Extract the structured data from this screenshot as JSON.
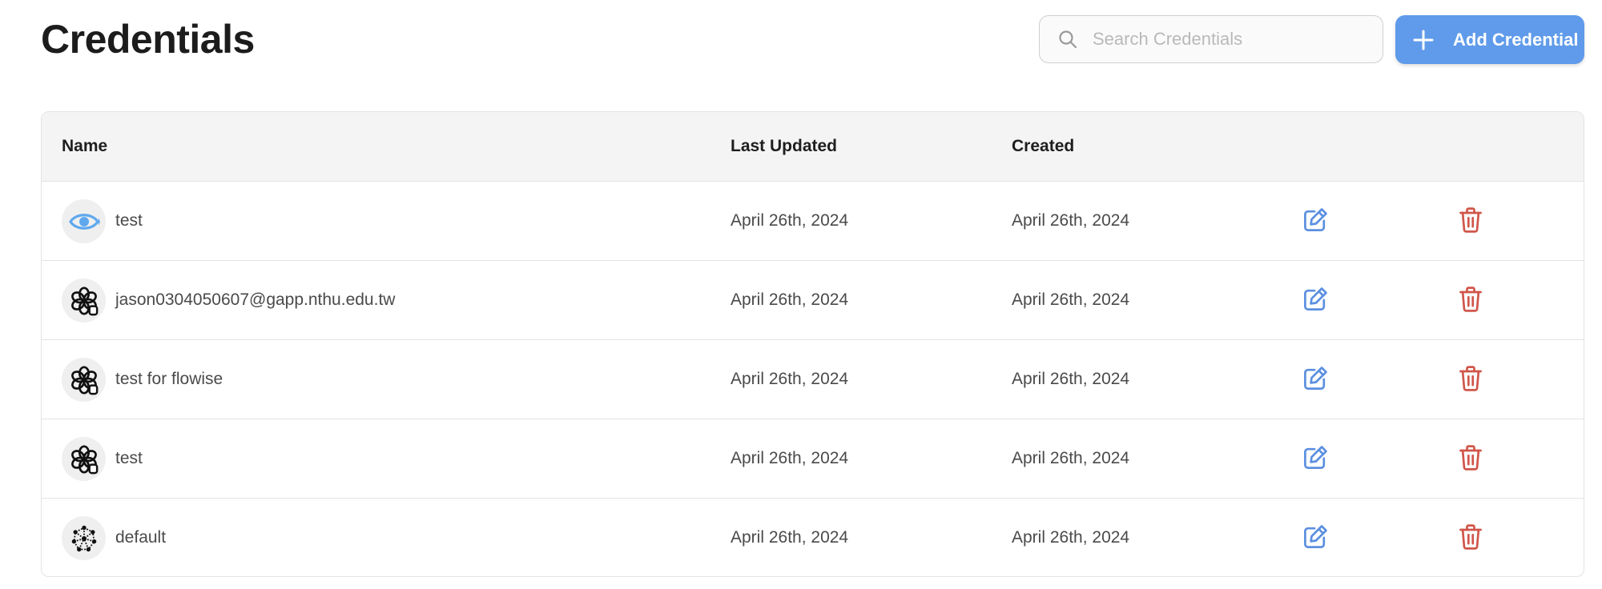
{
  "page": {
    "title": "Credentials"
  },
  "search": {
    "placeholder": "Search Credentials",
    "icon": "search-icon"
  },
  "add_button": {
    "label": "Add Credential",
    "icon": "plus-icon",
    "color": "#5f9bea"
  },
  "table": {
    "headers": {
      "name": "Name",
      "last_updated": "Last Updated",
      "created": "Created"
    },
    "rows": [
      {
        "name": "test",
        "icon": "eye-icon",
        "last_updated": "April 26th, 2024",
        "created": "April 26th, 2024"
      },
      {
        "name": "jason0304050607@gapp.nthu.edu.tw",
        "icon": "openai-icon",
        "last_updated": "April 26th, 2024",
        "created": "April 26th, 2024"
      },
      {
        "name": "test for flowise",
        "icon": "openai-icon",
        "last_updated": "April 26th, 2024",
        "created": "April 26th, 2024"
      },
      {
        "name": "test",
        "icon": "openai-icon",
        "last_updated": "April 26th, 2024",
        "created": "April 26th, 2024"
      },
      {
        "name": "default",
        "icon": "network-icon",
        "last_updated": "April 26th, 2024",
        "created": "April 26th, 2024"
      }
    ]
  },
  "colors": {
    "edit": "#5b8fe0",
    "delete": "#d0564a"
  }
}
